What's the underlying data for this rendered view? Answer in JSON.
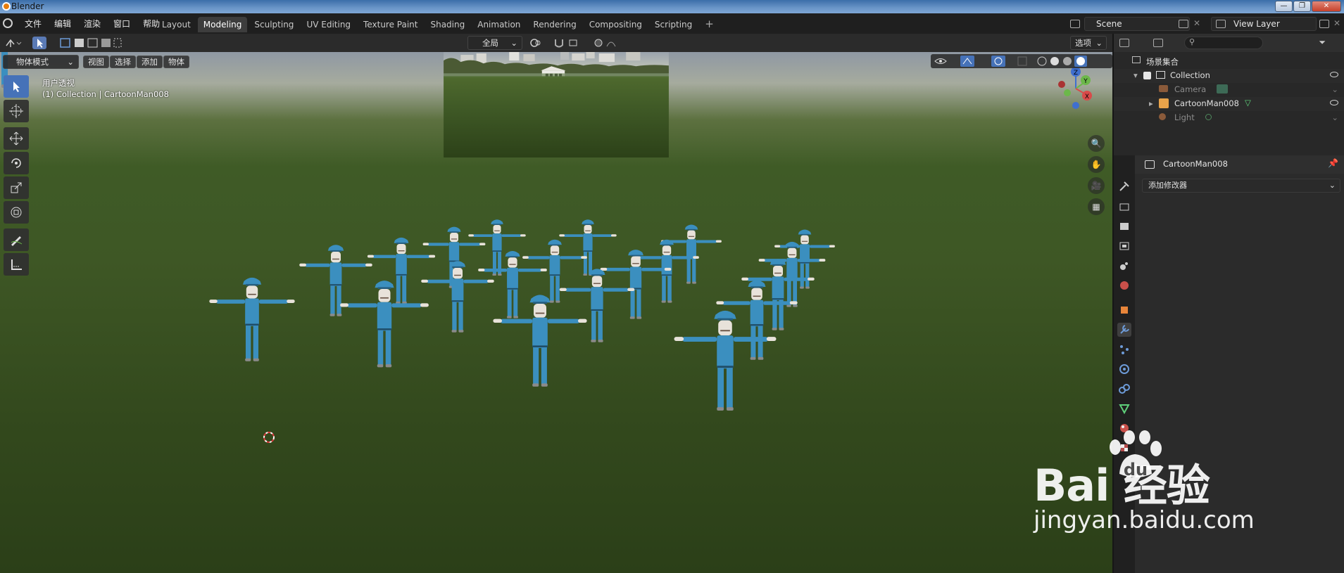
{
  "window": {
    "title": "Blender"
  },
  "menu": [
    "文件",
    "编辑",
    "渲染",
    "窗口",
    "帮助"
  ],
  "workspaces": [
    {
      "label": "Layout",
      "active": false
    },
    {
      "label": "Modeling",
      "active": true
    },
    {
      "label": "Sculpting",
      "active": false
    },
    {
      "label": "UV Editing",
      "active": false
    },
    {
      "label": "Texture Paint",
      "active": false
    },
    {
      "label": "Shading",
      "active": false
    },
    {
      "label": "Animation",
      "active": false
    },
    {
      "label": "Rendering",
      "active": false
    },
    {
      "label": "Compositing",
      "active": false
    },
    {
      "label": "Scripting",
      "active": false
    }
  ],
  "tab_add": "+",
  "scene": {
    "name": "Scene"
  },
  "view_layer": {
    "name": "View Layer"
  },
  "header": {
    "transform_orientation": "全局",
    "options_label": "选项"
  },
  "viewport": {
    "mode": "物体模式",
    "menu": [
      "视图",
      "选择",
      "添加",
      "物体"
    ],
    "view_name": "用户透视",
    "collection_info": "(1) Collection | CartoonMan008",
    "gizmo": {
      "x": "X",
      "y": "Y",
      "z": "Z"
    }
  },
  "outliner": {
    "root": "场景集合",
    "items": [
      {
        "label": "Collection",
        "dim": false
      },
      {
        "label": "Camera",
        "dim": true
      },
      {
        "label": "CartoonMan008",
        "dim": false
      },
      {
        "label": "Light",
        "dim": true
      }
    ]
  },
  "properties": {
    "object_name": "CartoonMan008",
    "add_modifier": "添加修改器"
  },
  "watermark": {
    "brand": "Bai   经验",
    "url": "jingyan.baidu.com"
  },
  "colors": {
    "accent": "#4672b8",
    "character_blue": "#3b8fbf",
    "grass": "#3e5725"
  }
}
